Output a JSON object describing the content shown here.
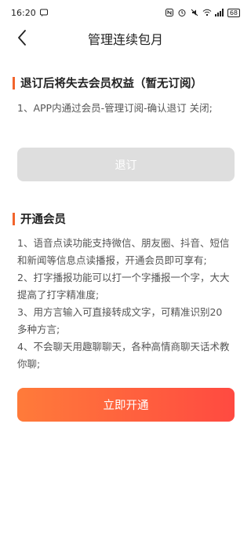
{
  "status_bar": {
    "time": "16:20",
    "battery": "68"
  },
  "nav": {
    "title": "管理连续包月"
  },
  "section1": {
    "title": "退订后将失去会员权益（暂无订阅）",
    "lines": [
      "1、APP内通过会员-管理订阅-确认退订 关闭;"
    ]
  },
  "unsubscribe_button": {
    "label": "退订"
  },
  "section2": {
    "title": "开通会员",
    "lines": [
      "1、语音点读功能支持微信、朋友圈、抖音、短信",
      "和新闻等信息点读播报，开通会员即可享有;",
      "2、打字播报功能可以打一个字播报一个字，大大",
      "提高了打字精准度;",
      "3、用方言输入可直接转成文字，可精准识别20",
      "多种方言;",
      "4、不会聊天用趣聊聊天，各种高情商聊天话术教",
      "你聊;"
    ]
  },
  "open_button": {
    "label": "立即开通"
  },
  "colors": {
    "accent": "#f2642c",
    "primary_start": "#ff7b3a",
    "primary_end": "#ff4a41",
    "disabled": "#dedede"
  },
  "icons": [
    "message-icon",
    "nfc-icon",
    "alarm-icon",
    "mute-icon",
    "wifi-icon",
    "signal-icon",
    "battery-icon",
    "back-arrow-icon"
  ]
}
